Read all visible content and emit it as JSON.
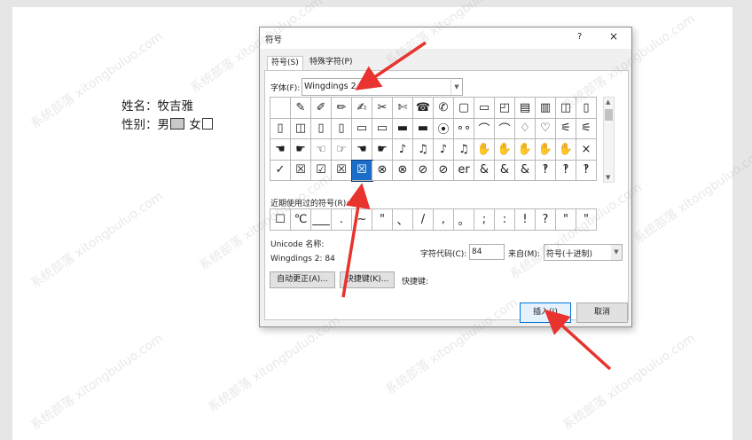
{
  "document": {
    "line1": "姓名：牧吉雅",
    "line2_label": "性别：男",
    "line2_female": "女"
  },
  "dialog": {
    "title": "符号",
    "help": "?",
    "close": "×",
    "tabs": [
      {
        "label": "符号(S)"
      },
      {
        "label": "特殊字符(P)"
      }
    ],
    "font_label": "字体(F):",
    "font_value": "Wingdings 2",
    "symbols": [
      "",
      "✎",
      "✐",
      "✏",
      "✍",
      "✂",
      "✄",
      "☎",
      "✆",
      "▢",
      "▭",
      "◰",
      "▤",
      "▥",
      "◫",
      "▯",
      "▯",
      "◫",
      "▯",
      "▯",
      "▭",
      "▭",
      "▬",
      "▬",
      "⦿",
      "∘∘",
      "⌒",
      "⌒",
      "♢",
      "♡",
      "⚟",
      "⚟",
      "☚",
      "☛",
      "☜",
      "☞",
      "☚",
      "☛",
      "♪",
      "♫",
      "♪",
      "♫",
      "✋",
      "✋",
      "✋",
      "✋",
      "✋",
      "×",
      "✓",
      "☒",
      "☑",
      "☒",
      "☒",
      "⊗",
      "⊗",
      "⊘",
      "⊘",
      "er",
      "&",
      "&",
      "&",
      "‽",
      "‽",
      "‽"
    ],
    "selected_index": 52,
    "recent_label": "近期使用过的符号(R):",
    "recent_symbols": [
      "☐",
      "℃",
      "___",
      ".",
      "~",
      "\"",
      "、",
      "/",
      ",",
      "。",
      ";",
      ":",
      "!",
      "?",
      "\"",
      "\""
    ],
    "unicode_name_label": "Unicode 名称:",
    "unicode_name_value": "Wingdings 2: 84",
    "charcode_label": "字符代码(C):",
    "charcode_value": "84",
    "from_label": "来自(M):",
    "from_value": "符号(十进制)",
    "autocorrect_button": "自动更正(A)...",
    "shortcut_button": "快捷键(K)...",
    "shortcut_label": "快捷键:",
    "insert_button": "插入(I)",
    "cancel_button": "取消"
  },
  "watermark_text": "系统部落 xitongbuluo.com"
}
